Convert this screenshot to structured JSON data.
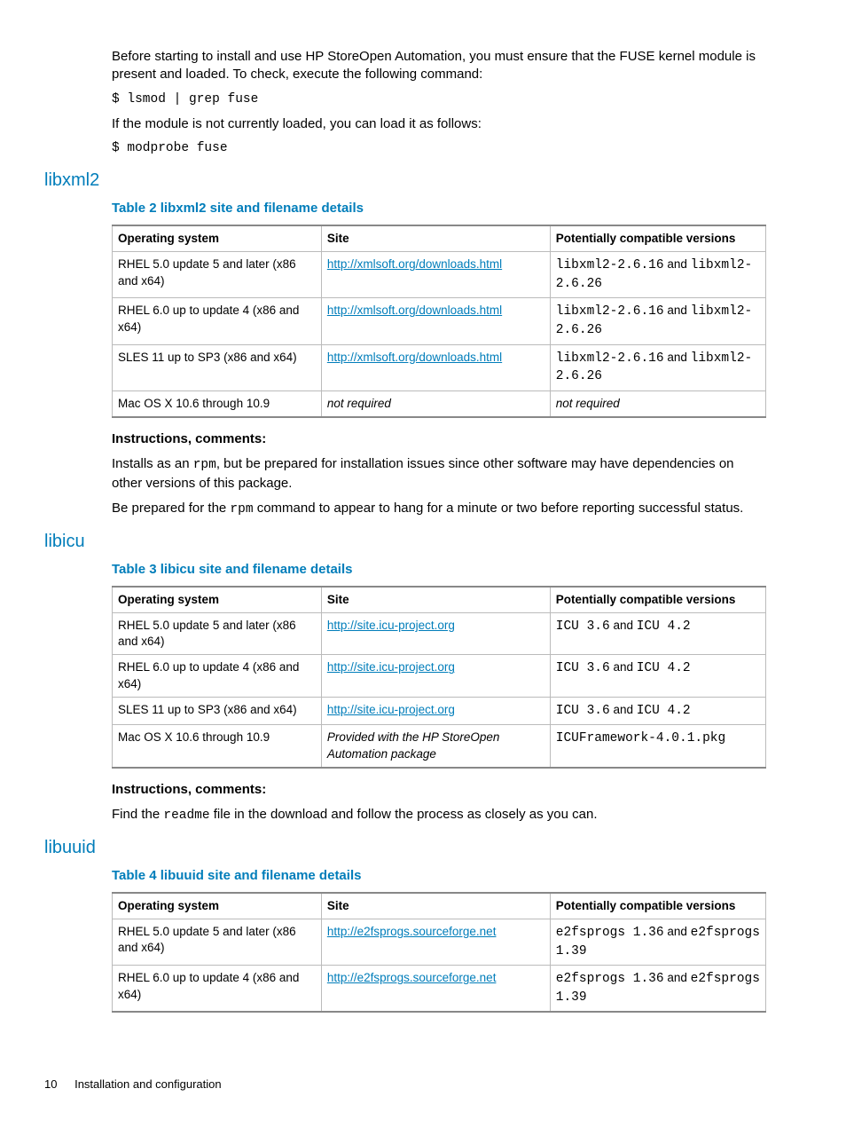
{
  "intro": {
    "p1": "Before starting to install and use HP StoreOpen Automation, you must ensure that the FUSE kernel module is present and loaded. To check, execute the following command:",
    "cmd1": "$ lsmod | grep fuse",
    "p2": "If the module is not currently loaded, you can load it as follows:",
    "cmd2": "$ modprobe fuse"
  },
  "sections": {
    "libxml2": {
      "heading": "libxml2",
      "table_title": "Table 2 libxml2 site and filename details",
      "headers": {
        "os": "Operating system",
        "site": "Site",
        "ver": "Potentially compatible versions"
      },
      "rows": [
        {
          "os": "RHEL 5.0 update 5 and later (x86 and x64)",
          "site_link": "http://xmlsoft.org/downloads.html",
          "ver_pre": "libxml2-2.6.16",
          "ver_mid": " and ",
          "ver_post": "libxml2-2.6.26"
        },
        {
          "os": "RHEL 6.0 up to update 4 (x86 and x64)",
          "site_link": "http://xmlsoft.org/downloads.html",
          "ver_pre": "libxml2-2.6.16",
          "ver_mid": " and ",
          "ver_post": "libxml2-2.6.26"
        },
        {
          "os": "SLES 11 up to SP3 (x86 and x64)",
          "site_link": "http://xmlsoft.org/downloads.html",
          "ver_pre": "libxml2-2.6.16",
          "ver_mid": " and ",
          "ver_post": "libxml2-2.6.26"
        },
        {
          "os": "Mac OS X 10.6 through 10.9",
          "site_text": "not required",
          "ver_text": "not required"
        }
      ],
      "instr_head": "Instructions, comments:",
      "instr_p1a": "Installs as an ",
      "instr_p1code": "rpm",
      "instr_p1b": ", but be prepared for installation issues since other software may have dependencies on other versions of this package.",
      "instr_p2a": "Be prepared for the ",
      "instr_p2code": "rpm",
      "instr_p2b": " command to appear to hang for a minute or two before reporting successful status."
    },
    "libicu": {
      "heading": "libicu",
      "table_title": "Table 3 libicu site and filename details",
      "headers": {
        "os": "Operating system",
        "site": "Site",
        "ver": "Potentially compatible versions"
      },
      "rows": [
        {
          "os": "RHEL 5.0 update 5 and later (x86 and x64)",
          "site_link": "http://site.icu-project.org",
          "ver_pre": "ICU 3.6",
          "ver_mid": " and ",
          "ver_post": "ICU 4.2"
        },
        {
          "os": "RHEL 6.0 up to update 4 (x86 and x64)",
          "site_link": "http://site.icu-project.org",
          "ver_pre": "ICU 3.6",
          "ver_mid": " and ",
          "ver_post": "ICU 4.2"
        },
        {
          "os": "SLES 11 up to SP3 (x86 and x64)",
          "site_link": "http://site.icu-project.org",
          "ver_pre": "ICU 3.6",
          "ver_mid": " and ",
          "ver_post": "ICU 4.2"
        },
        {
          "os": "Mac OS X 10.6 through 10.9",
          "site_text": "Provided with the HP StoreOpen Automation package",
          "ver_code": "ICUFramework-4.0.1.pkg"
        }
      ],
      "instr_head": "Instructions, comments:",
      "instr_p1a": "Find the ",
      "instr_p1code": "readme",
      "instr_p1b": " file in the download and follow the process as closely as you can."
    },
    "libuuid": {
      "heading": "libuuid",
      "table_title": "Table 4 libuuid site and filename details",
      "headers": {
        "os": "Operating system",
        "site": "Site",
        "ver": "Potentially compatible versions"
      },
      "rows": [
        {
          "os": "RHEL 5.0 update 5 and later (x86 and x64)",
          "site_link": "http://e2fsprogs.sourceforge.net",
          "ver_pre": "e2fsprogs 1.36",
          "ver_mid": " and ",
          "ver_post": "e2fsprogs 1.39"
        },
        {
          "os": "RHEL 6.0 up to update 4 (x86 and x64)",
          "site_link": "http://e2fsprogs.sourceforge.net",
          "ver_pre": "e2fsprogs 1.36",
          "ver_mid": " and ",
          "ver_post": "e2fsprogs 1.39"
        }
      ]
    }
  },
  "footer": {
    "page": "10",
    "title": "Installation and configuration"
  }
}
